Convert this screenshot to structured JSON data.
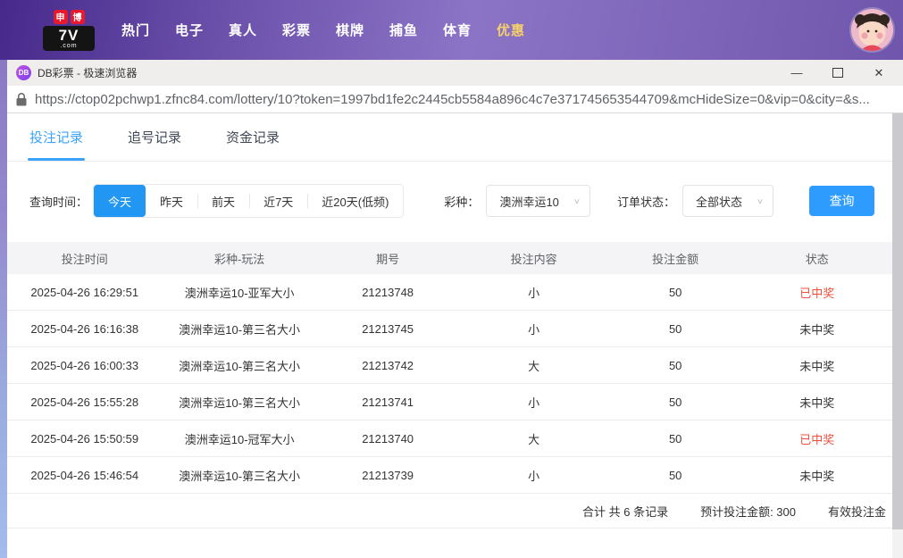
{
  "colors": {
    "nav_gradient_start": "#46298b",
    "nav_gradient_mid": "#8b74c6",
    "nav_highlight": "#f6d06a",
    "accent_blue": "#2e9cff",
    "tab_active_blue": "#3aa2f8",
    "segment_active_blue": "#2196f3",
    "won_red": "#f0503c",
    "header_bg": "#f4f4f6",
    "titlebar_bg": "#f0eeed"
  },
  "top_nav": {
    "logo": {
      "badge_left": "申",
      "badge_right": "博",
      "main": "7V",
      "suffix": ".com"
    },
    "items": [
      {
        "name": "nav-item-hot",
        "label": "热门"
      },
      {
        "name": "nav-item-electronic",
        "label": "电子"
      },
      {
        "name": "nav-item-live",
        "label": "真人"
      },
      {
        "name": "nav-item-lottery",
        "label": "彩票"
      },
      {
        "name": "nav-item-chess",
        "label": "棋牌"
      },
      {
        "name": "nav-item-fishing",
        "label": "捕鱼"
      },
      {
        "name": "nav-item-sports",
        "label": "体育"
      },
      {
        "name": "nav-item-promo",
        "label": "优惠",
        "highlight": true
      }
    ]
  },
  "browser": {
    "title": "DB彩票 - 极速浏览器",
    "app_icon_text": "DB",
    "url": "https://ctop02pchwp1.zfnc84.com/lottery/10?token=1997bd1fe2c2445cb5584a896c4c7e371745653544709&mcHideSize=0&vip=0&city=&s...",
    "controls": {
      "minimize": "—",
      "close": "✕"
    }
  },
  "tabs": [
    {
      "name": "tab-bet-records",
      "label": "投注记录",
      "active": true
    },
    {
      "name": "tab-chase-records",
      "label": "追号记录"
    },
    {
      "name": "tab-fund-records",
      "label": "资金记录"
    }
  ],
  "filters": {
    "time_label": "查询时间：",
    "time_options": [
      {
        "name": "time-option-today",
        "label": "今天",
        "active": true
      },
      {
        "name": "time-option-yesterday",
        "label": "昨天"
      },
      {
        "name": "time-option-day-before",
        "label": "前天"
      },
      {
        "name": "time-option-7days",
        "label": "近7天"
      },
      {
        "name": "time-option-20days",
        "label": "近20天(低频)"
      }
    ],
    "lottery_label": "彩种：",
    "lottery_value": "澳洲幸运10",
    "status_label": "订单状态：",
    "status_value": "全部状态",
    "query_button": "查询"
  },
  "table": {
    "headers": {
      "time": "投注时间",
      "play": "彩种-玩法",
      "issue": "期号",
      "content": "投注内容",
      "amount": "投注金额",
      "status": "状态"
    },
    "rows": [
      {
        "time": "2025-04-26 16:29:51",
        "play": "澳洲幸运10-亚军大小",
        "issue": "21213748",
        "content": "小",
        "amount": "50",
        "status": "已中奖",
        "won": true
      },
      {
        "time": "2025-04-26 16:16:38",
        "play": "澳洲幸运10-第三名大小",
        "issue": "21213745",
        "content": "小",
        "amount": "50",
        "status": "未中奖"
      },
      {
        "time": "2025-04-26 16:00:33",
        "play": "澳洲幸运10-第三名大小",
        "issue": "21213742",
        "content": "大",
        "amount": "50",
        "status": "未中奖"
      },
      {
        "time": "2025-04-26 15:55:28",
        "play": "澳洲幸运10-第三名大小",
        "issue": "21213741",
        "content": "小",
        "amount": "50",
        "status": "未中奖"
      },
      {
        "time": "2025-04-26 15:50:59",
        "play": "澳洲幸运10-冠军大小",
        "issue": "21213740",
        "content": "大",
        "amount": "50",
        "status": "已中奖",
        "won": true
      },
      {
        "time": "2025-04-26 15:46:54",
        "play": "澳洲幸运10-第三名大小",
        "issue": "21213739",
        "content": "小",
        "amount": "50",
        "status": "未中奖"
      }
    ],
    "summary": {
      "total": "合计 共 6 条记录",
      "expected": "预计投注金额: 300",
      "valid": "有效投注金"
    }
  }
}
